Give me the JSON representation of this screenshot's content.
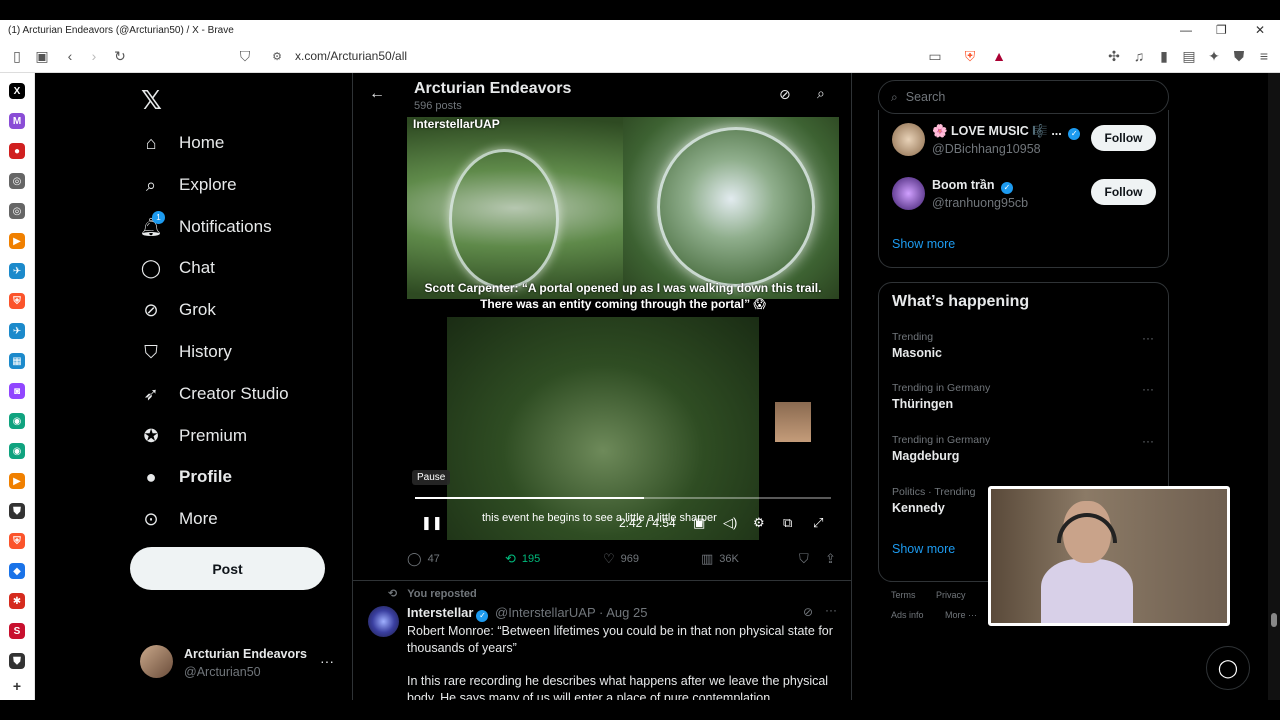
{
  "window": {
    "title": "(1) Arcturian Endeavors (@Arcturian50) / X - Brave"
  },
  "browser": {
    "url": "x.com/Arcturian50/all"
  },
  "nav": {
    "items": [
      {
        "label": "Home",
        "icon": "home-icon"
      },
      {
        "label": "Explore",
        "icon": "search-icon"
      },
      {
        "label": "Notifications",
        "icon": "bell-icon",
        "badge": "1"
      },
      {
        "label": "Chat",
        "icon": "chat-icon"
      },
      {
        "label": "Grok",
        "icon": "grok-icon"
      },
      {
        "label": "History",
        "icon": "bookmark-icon"
      },
      {
        "label": "Creator Studio",
        "icon": "rocket-icon"
      },
      {
        "label": "Premium",
        "icon": "premium-icon"
      },
      {
        "label": "Profile",
        "icon": "person-icon"
      },
      {
        "label": "More",
        "icon": "more-circle-icon"
      }
    ],
    "post_label": "Post",
    "account": {
      "name": "Arcturian Endeavors",
      "handle": "@Arcturian50"
    }
  },
  "profile_header": {
    "title": "Arcturian Endeavors",
    "posts": "596 posts"
  },
  "video": {
    "watermark": "InterstellarUAP",
    "caption": "Scott Carpenter: “A portal opened up as I was walking down this trail. There was an entity coming through the portal” 😱",
    "tooltip": "Pause",
    "subtitle": "this event he begins to see a little a little sharper",
    "time": "2:42 / 4:54",
    "progress": 0.55
  },
  "actions": {
    "replies": "47",
    "reposts": "195",
    "likes": "969",
    "views": "36K"
  },
  "tweet": {
    "repost_label": "You reposted",
    "name": "Interstellar",
    "handle_date": "@InterstellarUAP · Aug 25",
    "text1": "Robert Monroe: “Between lifetimes you could be in that non physical state for thousands of years”",
    "text2": "In this rare recording he describes what happens after we leave the physical body. He says many of us will enter a place of pure contemplation"
  },
  "right": {
    "search_placeholder": "Search",
    "who_to_follow": [
      {
        "name": "🌸 LOVE MUSIC 🎼 ...",
        "handle": "@DBichhang10958",
        "follow": "Follow"
      },
      {
        "name": "Boom trần",
        "handle": "@tranhuong95cb",
        "follow": "Follow"
      }
    ],
    "show_more": "Show more",
    "happening_title": "What’s happening",
    "trends": [
      {
        "meta": "Trending",
        "name": "Masonic"
      },
      {
        "meta": "Trending in Germany",
        "name": "Thüringen"
      },
      {
        "meta": "Trending in Germany",
        "name": "Magdeburg"
      },
      {
        "meta": "Politics · Trending",
        "name": "Kennedy"
      }
    ],
    "show_more2": "Show more",
    "footer": {
      "terms": "Terms",
      "privacy": "Privacy",
      "ads": "Ads info",
      "more": "More ···"
    }
  }
}
